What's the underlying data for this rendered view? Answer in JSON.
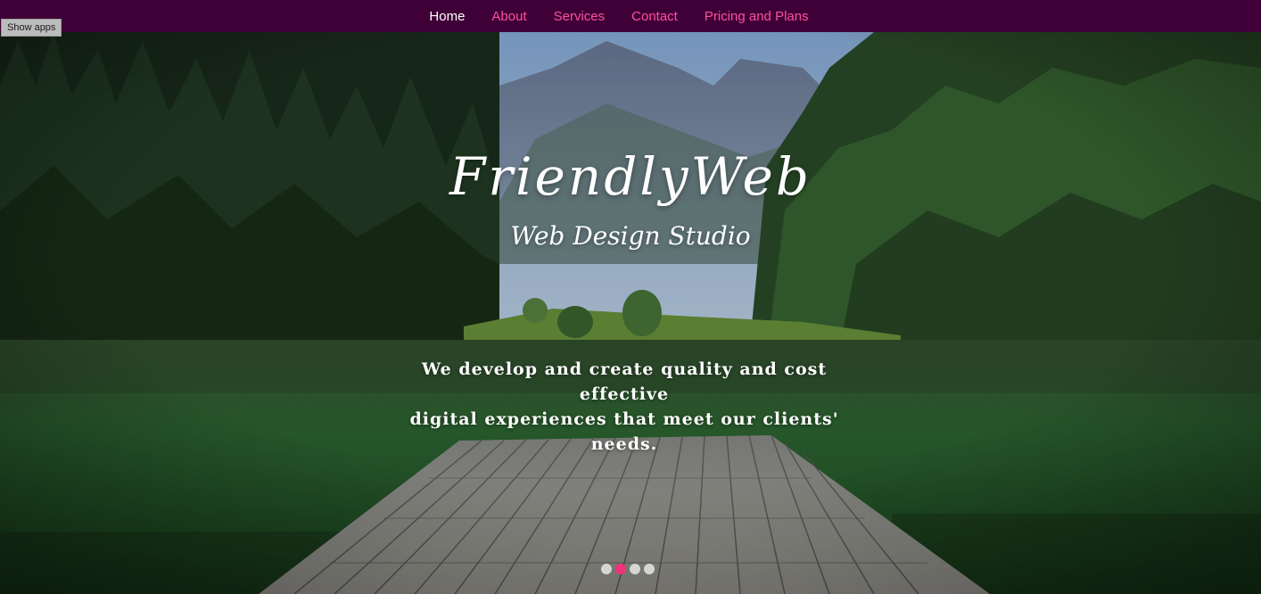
{
  "nav": {
    "items": [
      {
        "label": "Home",
        "active": true
      },
      {
        "label": "About",
        "active": false
      },
      {
        "label": "Services",
        "active": false
      },
      {
        "label": "Contact",
        "active": false
      },
      {
        "label": "Pricing and Plans",
        "active": false
      }
    ]
  },
  "show_apps_label": "Show apps",
  "hero": {
    "title": "FriendlyWeb",
    "subtitle": "Web Design Studio",
    "tagline_line1": "We develop and create quality and cost effective",
    "tagline_line2": "digital experiences that meet our clients' needs."
  },
  "slideshow": {
    "slide_count": 4,
    "active_index": 1
  },
  "colors": {
    "nav_background": "#3f0038",
    "nav_link": "#ff4f9d",
    "nav_link_active": "#ffffff",
    "slide_dot_active": "#f0317b",
    "slide_dot": "#e6e6e6"
  }
}
